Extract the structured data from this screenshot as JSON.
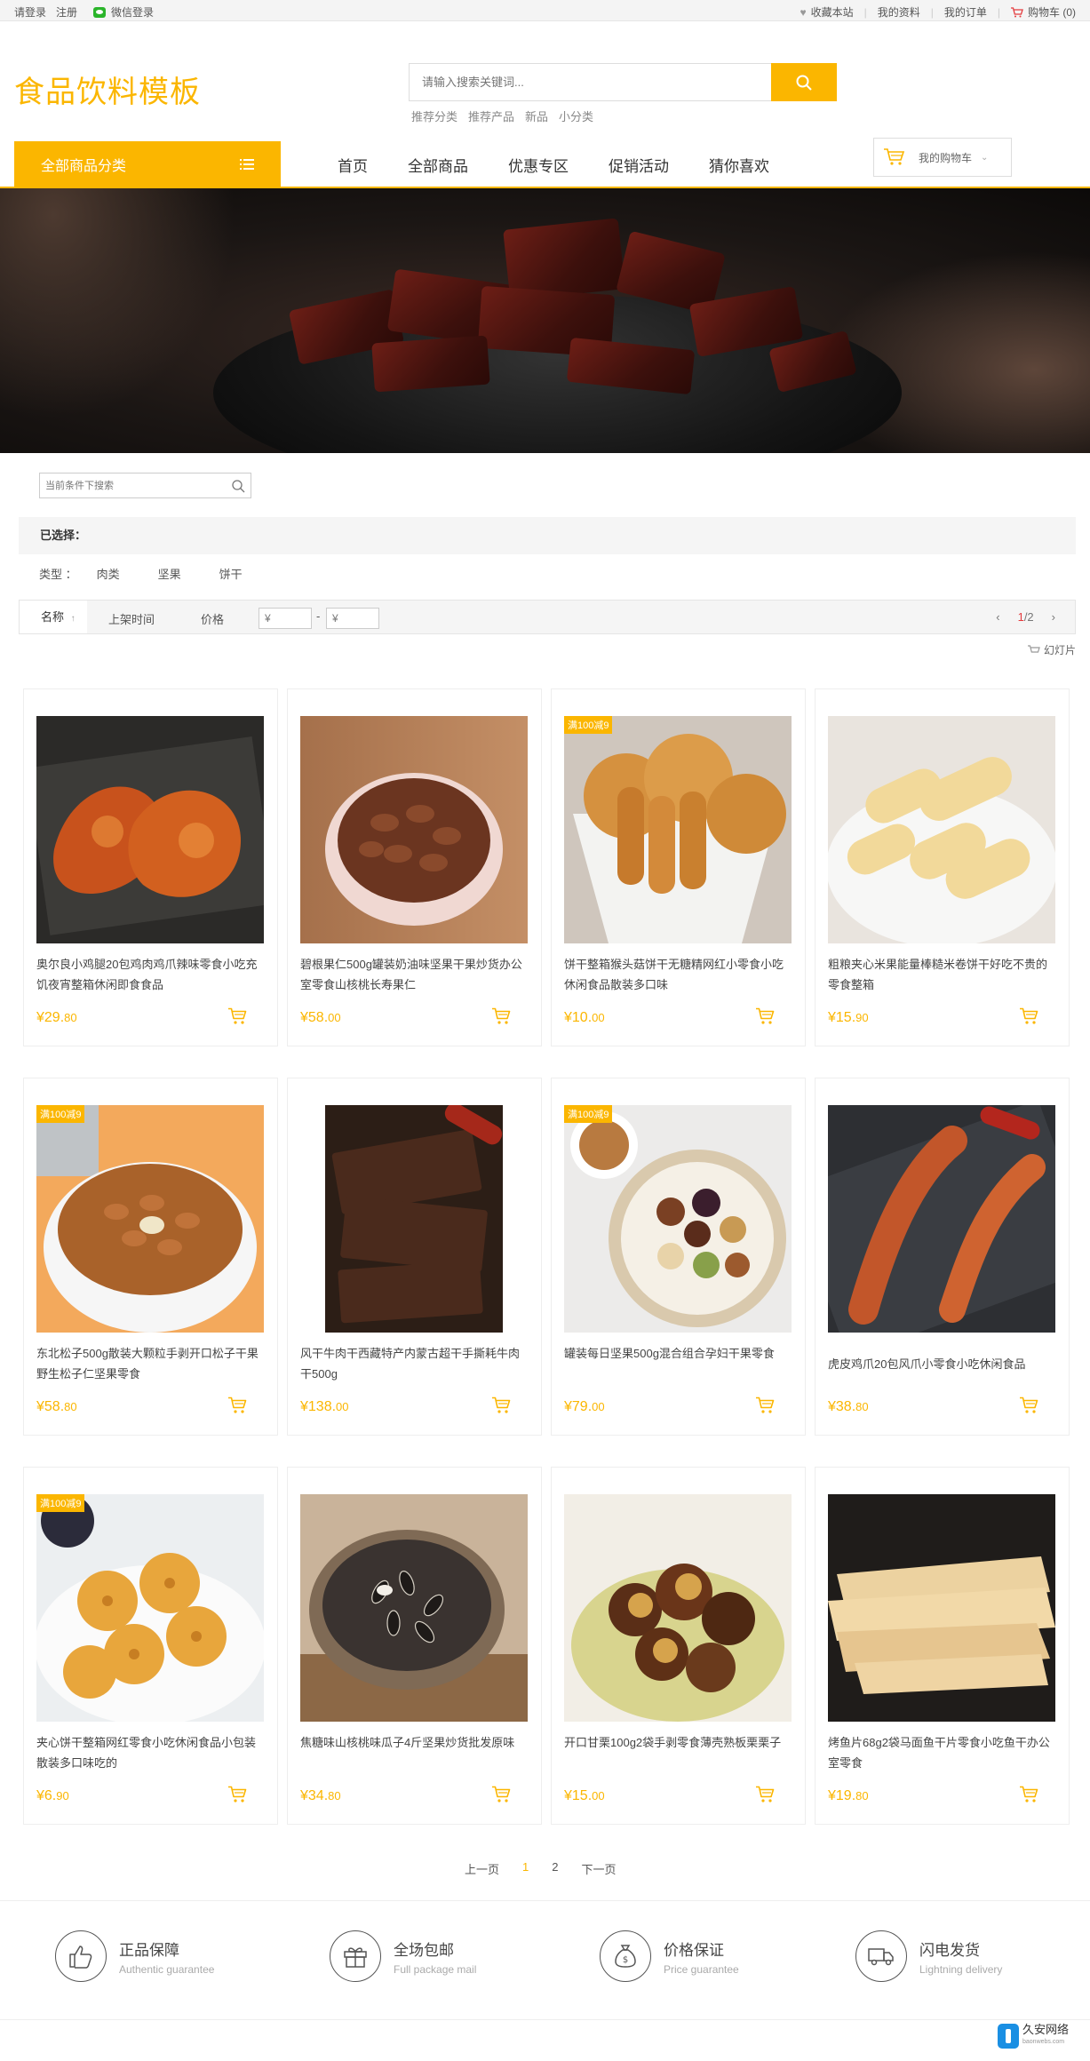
{
  "topbar": {
    "login": "请登录",
    "register": "注册",
    "wechat_login": "微信登录",
    "favorite": "收藏本站",
    "my_profile": "我的资料",
    "my_orders": "我的订单",
    "cart": "购物车 (0)"
  },
  "header": {
    "logo": "食品饮料模板",
    "search_placeholder": "请输入搜索关键词...",
    "hot_words": [
      "推荐分类",
      "推荐产品",
      "新品",
      "小分类"
    ]
  },
  "nav": {
    "all_categories": "全部商品分类",
    "items": [
      "首页",
      "全部商品",
      "优惠专区",
      "促销活动",
      "猜你喜欢"
    ],
    "my_cart": "我的购物车"
  },
  "filters": {
    "search_placeholder": "当前条件下搜索",
    "selected_label": "已选择：",
    "type_label": "类型 ：",
    "types": [
      "肉类",
      "坚果",
      "饼干"
    ],
    "sort_name": "名称",
    "sort_time": "上架时间",
    "sort_price": "价格",
    "price_from": "¥",
    "price_to": "¥",
    "price_dash": "-",
    "page_current": "1",
    "page_total": "/2",
    "slides": "幻灯片"
  },
  "products": [
    {
      "title": "奥尔良小鸡腿20包鸡肉鸡爪辣味零食小吃充饥夜宵整箱休闲即食食品",
      "price_int": "¥29.",
      "price_dec": "80",
      "badge": "",
      "image": "roasted-chicken-wings"
    },
    {
      "title": "碧根果仁500g罐装奶油味坚果干果炒货办公室零食山核桃长寿果仁",
      "price_int": "¥58.",
      "price_dec": "00",
      "badge": "",
      "image": "pecans-bowl"
    },
    {
      "title": "饼干整箱猴头菇饼干无糖精网红小零食小吃休闲食品散装多口味",
      "price_int": "¥10.",
      "price_dec": "00",
      "badge": "满100减9",
      "image": "round-biscuits"
    },
    {
      "title": "粗粮夹心米果能量棒糙米卷饼干好吃不贵的零食整箱",
      "price_int": "¥15.",
      "price_dec": "90",
      "badge": "",
      "image": "rice-rolls"
    },
    {
      "title": "东北松子500g散装大颗粒手剥开口松子干果野生松子仁坚果零食",
      "price_int": "¥58.",
      "price_dec": "80",
      "badge": "满100减9",
      "image": "pine-nuts"
    },
    {
      "title": "风干牛肉干西藏特产内蒙古超干手撕耗牛肉干500g",
      "price_int": "¥138.",
      "price_dec": "00",
      "badge": "",
      "image": "beef-jerky"
    },
    {
      "title": "罐装每日坚果500g混合组合孕妇干果零食",
      "price_int": "¥79.",
      "price_dec": "00",
      "badge": "满100减9",
      "image": "mixed-nuts"
    },
    {
      "title": "虎皮鸡爪20包风爪小零食小吃休闲食品",
      "price_int": "¥38.",
      "price_dec": "80",
      "badge": "",
      "image": "chicken-feet"
    },
    {
      "title": "夹心饼干整箱网红零食小吃休闲食品小包装散装多口味吃的",
      "price_int": "¥6.",
      "price_dec": "90",
      "badge": "满100减9",
      "image": "flower-crackers"
    },
    {
      "title": "焦糖味山核桃味瓜子4斤坚果炒货批发原味",
      "price_int": "¥34.",
      "price_dec": "80",
      "badge": "",
      "image": "sunflower-seeds"
    },
    {
      "title": "开口甘栗100g2袋手剥零食薄壳熟板栗栗子",
      "price_int": "¥15.",
      "price_dec": "00",
      "badge": "",
      "image": "chestnuts"
    },
    {
      "title": "烤鱼片68g2袋马面鱼干片零食小吃鱼干办公室零食",
      "price_int": "¥19.",
      "price_dec": "80",
      "badge": "",
      "image": "dried-fish-slices"
    }
  ],
  "pagination": {
    "prev": "上一页",
    "p1": "1",
    "p2": "2",
    "next": "下一页"
  },
  "services": [
    {
      "title": "正品保障",
      "subtitle": "Authentic guarantee",
      "icon": "thumbs-up-icon"
    },
    {
      "title": "全场包邮",
      "subtitle": "Full package mail",
      "icon": "gift-icon"
    },
    {
      "title": "价格保证",
      "subtitle": "Price guarantee",
      "icon": "money-bag-icon"
    },
    {
      "title": "闪电发货",
      "subtitle": "Lightning delivery",
      "icon": "truck-icon"
    }
  ],
  "watermark": {
    "name": "久安网络",
    "url": "baonwebs.com"
  },
  "colors": {
    "accent": "#fbb600",
    "price": "#fbb600",
    "cart_red": "#e4393c"
  }
}
